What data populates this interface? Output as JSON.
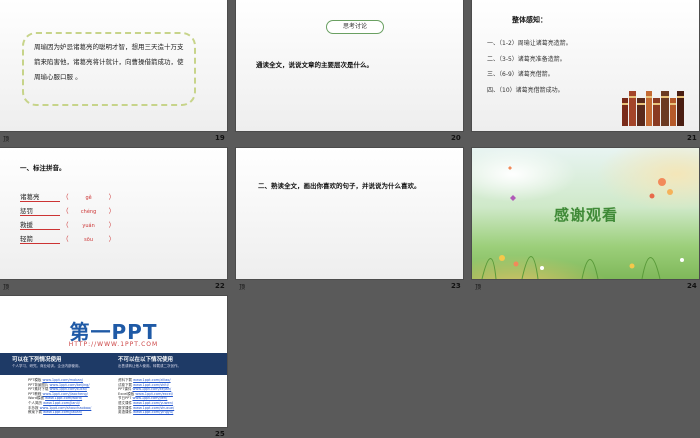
{
  "slides": {
    "s19": {
      "number": "19",
      "corner": "顶",
      "text": "周瑜因为妒忌诸葛亮的聪明才智，想用三天造十万支箭来陷害他，诸葛亮将计就计，向曹操借箭成功，使周瑜心服口服 。"
    },
    "s20": {
      "number": "20",
      "pill": "思考讨论",
      "question": "通读全文，说说文章的主要层次是什么。"
    },
    "s21": {
      "number": "21",
      "title": "整体感知：",
      "items": [
        "一、（1-2）周瑜让诸葛亮造箭。",
        "二、（3-5）诸葛亮准备造箭。",
        "三、（6-9）诸葛亮借箭。",
        "四、（10）诸葛亮借箭成功。"
      ],
      "book_colors": [
        "#7a2b1a",
        "#a4452a",
        "#5b2a1b",
        "#c46a33",
        "#8a3a22",
        "#6b3a22",
        "#b55a2a",
        "#4a1e12"
      ]
    },
    "s22": {
      "number": "22",
      "corner": "顶",
      "title": "一、标注拼音。",
      "rows": [
        {
          "word": "诸葛亮",
          "pinyin": "gě"
        },
        {
          "word": "惩罚",
          "pinyin": "chéng"
        },
        {
          "word": "救援",
          "pinyin": "yuán"
        },
        {
          "word": "轻箭",
          "pinyin": "sōu"
        }
      ]
    },
    "s23": {
      "number": "23",
      "corner": "顶",
      "question": "二、熟读全文，画出你喜欢的句子，并说说为什么喜欢。"
    },
    "s24": {
      "number": "24",
      "corner": "顶",
      "text": "感谢观看"
    },
    "s25": {
      "number": "25",
      "corner": "顶",
      "logo": "第一PPT",
      "url": "HTTP://WWW.1PPT.COM",
      "can_use_title": "可以在下列情况使用",
      "can_use_sub": "个人学习、研究。商业培训。企业内部使用。",
      "cannot_use_title": "不可以在以下情况使用",
      "cannot_use_sub": "出售或转让他人使用。转载或二次创作。",
      "left_links": [
        [
          "PPT模板",
          "www.1ppt.com/moban/"
        ],
        [
          "PPT背景图片",
          "www.1ppt.com/beijing/"
        ],
        [
          "PPT素材下载",
          "www.1ppt.com/sucai/"
        ],
        [
          "PPT教程",
          "www.1ppt.com/jiaocheng/"
        ],
        [
          "Word模板",
          "www.1ppt.com/word/"
        ],
        [
          "个人简历",
          "www.1ppt.com/jianli/"
        ],
        [
          "手抄报",
          "www.1ppt.com/shouchaobao/"
        ],
        [
          "教案下载",
          "www.1ppt.com/jiaoan/"
        ]
      ],
      "right_links": [
        [
          "资料下载",
          "www.1ppt.com/ziliao/"
        ],
        [
          "试卷下载",
          "www.1ppt.com/shiti/"
        ],
        [
          "PPT课件",
          "www.1ppt.com/kejian/"
        ],
        [
          "Excel模板",
          "www.1ppt.com/excel/"
        ],
        [
          "节日PPT",
          "www.1ppt.com/jieri/"
        ],
        [
          "语文课件",
          "www.1ppt.com/yuwen/"
        ],
        [
          "数学课件",
          "www.1ppt.com/shuxue/"
        ],
        [
          "英语课件",
          "www.1ppt.com/yingyu/"
        ]
      ]
    }
  }
}
